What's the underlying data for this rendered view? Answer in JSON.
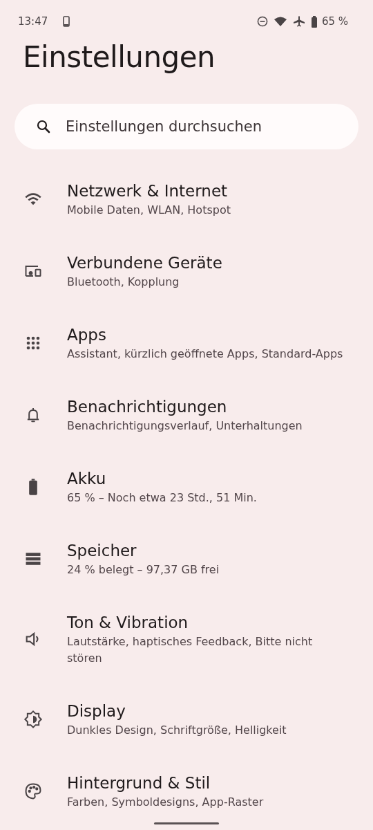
{
  "status_bar": {
    "time": "13:47",
    "battery": "65 %"
  },
  "title": "Einstellungen",
  "search": {
    "placeholder": "Einstellungen durchsuchen"
  },
  "items": [
    {
      "kind": "wifi",
      "title": "Netzwerk & Internet",
      "subtitle": "Mobile Daten, WLAN, Hotspot"
    },
    {
      "kind": "devices",
      "title": "Verbundene Geräte",
      "subtitle": "Bluetooth, Kopplung"
    },
    {
      "kind": "apps",
      "title": "Apps",
      "subtitle": "Assistant, kürzlich geöffnete Apps, Standard-Apps"
    },
    {
      "kind": "bell",
      "title": "Benachrichtigungen",
      "subtitle": "Benachrichtigungsverlauf, Unterhaltungen"
    },
    {
      "kind": "battery",
      "title": "Akku",
      "subtitle": "65 % – Noch etwa 23 Std., 51 Min."
    },
    {
      "kind": "storage",
      "title": "Speicher",
      "subtitle": "24 % belegt – 97,37 GB frei"
    },
    {
      "kind": "sound",
      "title": "Ton & Vibration",
      "subtitle": "Lautstärke, haptisches Feedback, Bitte nicht stören"
    },
    {
      "kind": "display",
      "title": "Display",
      "subtitle": "Dunkles Design, Schriftgröße, Helligkeit"
    },
    {
      "kind": "palette",
      "title": "Hintergrund & Stil",
      "subtitle": "Farben, Symboldesigns, App-Raster"
    }
  ]
}
